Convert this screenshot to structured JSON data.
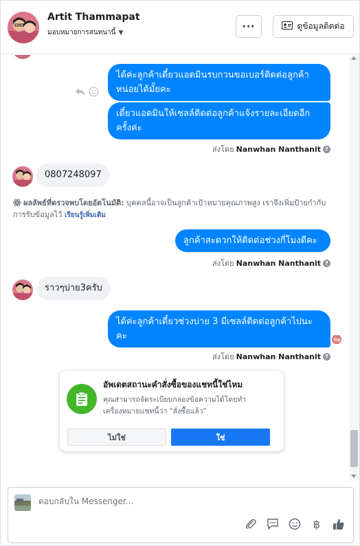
{
  "header": {
    "contact_name": "Artit Thammapat",
    "assign_label": "มอบหมายการสนทนานี้",
    "more_label": "···",
    "contact_info_label": "ดูข้อมูลติดต่อ"
  },
  "messages": [
    {
      "from": "page",
      "text": "ได้ค่ะลูกค้าเดี๋ยวแอดมินรบกวนขอเบอร์ติดต่อลูกค้าหน่อยได้มั้ยคะ"
    },
    {
      "from": "page",
      "text": "เดี๋ยวแอดมินให้เซลล์ติดต่อลูกค้าแจ้งรายละเอียดอีกครั้งค่ะ"
    },
    {
      "from": "customer",
      "text": "0807248097"
    },
    {
      "from": "page",
      "text": "ลูกค้าสะดวกให้ติดต่อช่วงกี่โมงดีคะ"
    },
    {
      "from": "customer",
      "text": "ราวๆบ่าย3ครับ"
    },
    {
      "from": "page",
      "text": "ได้ค่ะลูกค้าเดี๋ยวช่วงบ่าย 3 มีเซลล์ติดต่อลูกค้าไปนะคะ"
    }
  ],
  "sent_by": {
    "prefix": "ส่งโดย",
    "name": "Nanwhan Nanthanit"
  },
  "auto_detect": {
    "lead": "ผลลัพธ์ที่ตรวจพบโดยอัตโนมัติ:",
    "body": " บุคคลนี้อาจเป็นลูกค้าเป้าหมายคุณภาพสูง เราจึงเพิ่มป้ายกำกับการรับข้อมูลไว้",
    "link": "เรียนรู้เพิ่มเติม"
  },
  "order_card": {
    "title": "อัพเดตสถานะคำสั่งซื้อของแชทนี้ใช่ไหม",
    "description": "คุณสามารถจัดระเบียบกล่องข้อความได้โดยทำเครื่องหมายแชทนี้ว่า \"สั่งซื้อแล้ว\"",
    "no_label": "ไม่ใช่",
    "yes_label": "ใช่"
  },
  "composer": {
    "placeholder": "ตอบกลับใน Messenger..."
  },
  "icons": {
    "attach": "paperclip-icon",
    "saved_replies": "chat-bubble-icon",
    "emoji": "smiley-icon",
    "payment": "baht-icon",
    "like": "thumbs-up-icon"
  },
  "colors": {
    "outgoing_bubble": "#0084ff",
    "incoming_bubble": "#f0f2f5",
    "primary_button": "#1877f2",
    "card_icon": "#42b72a"
  }
}
